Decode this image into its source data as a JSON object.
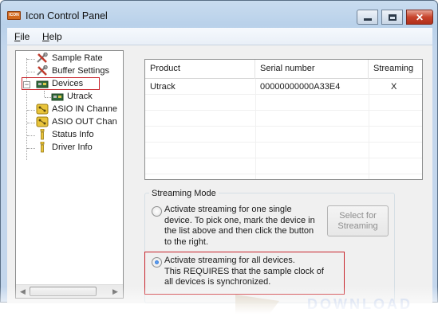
{
  "window": {
    "title": "Icon Control Panel",
    "app_icon_text": "ICON"
  },
  "menu": {
    "file_first": "F",
    "file_rest": "ile",
    "help_first": "H",
    "help_rest": "elp"
  },
  "tree": {
    "items": [
      {
        "label": "Sample Rate",
        "icon": "tools-icon"
      },
      {
        "label": "Buffer Settings",
        "icon": "tools-icon"
      },
      {
        "label": "Devices",
        "icon": "device-board-icon",
        "selected": true,
        "expander": "−"
      },
      {
        "label": "Utrack",
        "icon": "device-board-icon"
      },
      {
        "label": "ASIO IN Channe",
        "icon": "channel-icon"
      },
      {
        "label": "ASIO OUT Chan",
        "icon": "channel-icon"
      },
      {
        "label": "Status Info",
        "icon": "info-icon"
      },
      {
        "label": "Driver Info",
        "icon": "info-icon"
      }
    ]
  },
  "device_list": {
    "columns": [
      "Product",
      "Serial number",
      "Streaming"
    ],
    "rows": [
      {
        "product": "Utrack",
        "serial": "00000000000A33E4",
        "streaming": "X"
      }
    ]
  },
  "streaming": {
    "legend": "Streaming Mode",
    "option_single": [
      "Activate streaming for one single",
      "device. To pick one, mark the device in",
      "the list above and then click the button",
      "to the right."
    ],
    "option_all": [
      "Activate streaming for all devices.",
      "This REQUIRES that the sample clock of",
      "all devices is synchronized."
    ],
    "selected": "all",
    "select_button": [
      "Select for",
      "Streaming"
    ]
  },
  "colors": {
    "highlight_border": "#c8252c",
    "title_bar": "#b9d1ea"
  }
}
